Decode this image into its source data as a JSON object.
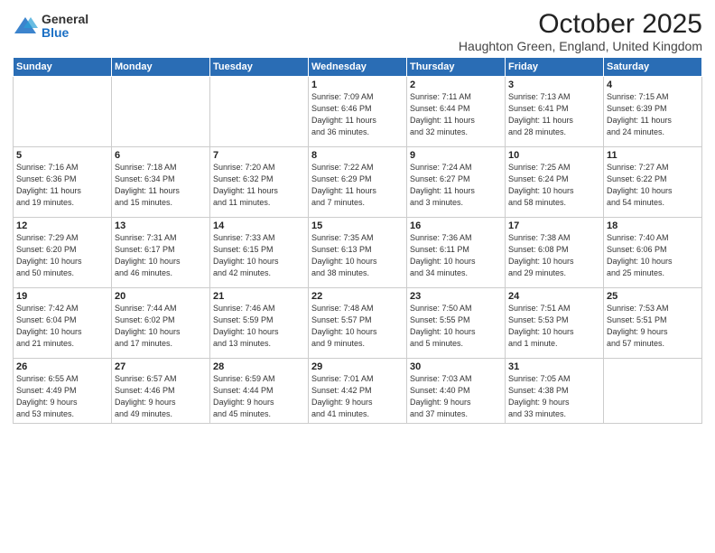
{
  "logo": {
    "general": "General",
    "blue": "Blue"
  },
  "title": "October 2025",
  "location": "Haughton Green, England, United Kingdom",
  "days_of_week": [
    "Sunday",
    "Monday",
    "Tuesday",
    "Wednesday",
    "Thursday",
    "Friday",
    "Saturday"
  ],
  "weeks": [
    [
      {
        "day": "",
        "info": ""
      },
      {
        "day": "",
        "info": ""
      },
      {
        "day": "",
        "info": ""
      },
      {
        "day": "1",
        "info": "Sunrise: 7:09 AM\nSunset: 6:46 PM\nDaylight: 11 hours\nand 36 minutes."
      },
      {
        "day": "2",
        "info": "Sunrise: 7:11 AM\nSunset: 6:44 PM\nDaylight: 11 hours\nand 32 minutes."
      },
      {
        "day": "3",
        "info": "Sunrise: 7:13 AM\nSunset: 6:41 PM\nDaylight: 11 hours\nand 28 minutes."
      },
      {
        "day": "4",
        "info": "Sunrise: 7:15 AM\nSunset: 6:39 PM\nDaylight: 11 hours\nand 24 minutes."
      }
    ],
    [
      {
        "day": "5",
        "info": "Sunrise: 7:16 AM\nSunset: 6:36 PM\nDaylight: 11 hours\nand 19 minutes."
      },
      {
        "day": "6",
        "info": "Sunrise: 7:18 AM\nSunset: 6:34 PM\nDaylight: 11 hours\nand 15 minutes."
      },
      {
        "day": "7",
        "info": "Sunrise: 7:20 AM\nSunset: 6:32 PM\nDaylight: 11 hours\nand 11 minutes."
      },
      {
        "day": "8",
        "info": "Sunrise: 7:22 AM\nSunset: 6:29 PM\nDaylight: 11 hours\nand 7 minutes."
      },
      {
        "day": "9",
        "info": "Sunrise: 7:24 AM\nSunset: 6:27 PM\nDaylight: 11 hours\nand 3 minutes."
      },
      {
        "day": "10",
        "info": "Sunrise: 7:25 AM\nSunset: 6:24 PM\nDaylight: 10 hours\nand 58 minutes."
      },
      {
        "day": "11",
        "info": "Sunrise: 7:27 AM\nSunset: 6:22 PM\nDaylight: 10 hours\nand 54 minutes."
      }
    ],
    [
      {
        "day": "12",
        "info": "Sunrise: 7:29 AM\nSunset: 6:20 PM\nDaylight: 10 hours\nand 50 minutes."
      },
      {
        "day": "13",
        "info": "Sunrise: 7:31 AM\nSunset: 6:17 PM\nDaylight: 10 hours\nand 46 minutes."
      },
      {
        "day": "14",
        "info": "Sunrise: 7:33 AM\nSunset: 6:15 PM\nDaylight: 10 hours\nand 42 minutes."
      },
      {
        "day": "15",
        "info": "Sunrise: 7:35 AM\nSunset: 6:13 PM\nDaylight: 10 hours\nand 38 minutes."
      },
      {
        "day": "16",
        "info": "Sunrise: 7:36 AM\nSunset: 6:11 PM\nDaylight: 10 hours\nand 34 minutes."
      },
      {
        "day": "17",
        "info": "Sunrise: 7:38 AM\nSunset: 6:08 PM\nDaylight: 10 hours\nand 29 minutes."
      },
      {
        "day": "18",
        "info": "Sunrise: 7:40 AM\nSunset: 6:06 PM\nDaylight: 10 hours\nand 25 minutes."
      }
    ],
    [
      {
        "day": "19",
        "info": "Sunrise: 7:42 AM\nSunset: 6:04 PM\nDaylight: 10 hours\nand 21 minutes."
      },
      {
        "day": "20",
        "info": "Sunrise: 7:44 AM\nSunset: 6:02 PM\nDaylight: 10 hours\nand 17 minutes."
      },
      {
        "day": "21",
        "info": "Sunrise: 7:46 AM\nSunset: 5:59 PM\nDaylight: 10 hours\nand 13 minutes."
      },
      {
        "day": "22",
        "info": "Sunrise: 7:48 AM\nSunset: 5:57 PM\nDaylight: 10 hours\nand 9 minutes."
      },
      {
        "day": "23",
        "info": "Sunrise: 7:50 AM\nSunset: 5:55 PM\nDaylight: 10 hours\nand 5 minutes."
      },
      {
        "day": "24",
        "info": "Sunrise: 7:51 AM\nSunset: 5:53 PM\nDaylight: 10 hours\nand 1 minute."
      },
      {
        "day": "25",
        "info": "Sunrise: 7:53 AM\nSunset: 5:51 PM\nDaylight: 9 hours\nand 57 minutes."
      }
    ],
    [
      {
        "day": "26",
        "info": "Sunrise: 6:55 AM\nSunset: 4:49 PM\nDaylight: 9 hours\nand 53 minutes."
      },
      {
        "day": "27",
        "info": "Sunrise: 6:57 AM\nSunset: 4:46 PM\nDaylight: 9 hours\nand 49 minutes."
      },
      {
        "day": "28",
        "info": "Sunrise: 6:59 AM\nSunset: 4:44 PM\nDaylight: 9 hours\nand 45 minutes."
      },
      {
        "day": "29",
        "info": "Sunrise: 7:01 AM\nSunset: 4:42 PM\nDaylight: 9 hours\nand 41 minutes."
      },
      {
        "day": "30",
        "info": "Sunrise: 7:03 AM\nSunset: 4:40 PM\nDaylight: 9 hours\nand 37 minutes."
      },
      {
        "day": "31",
        "info": "Sunrise: 7:05 AM\nSunset: 4:38 PM\nDaylight: 9 hours\nand 33 minutes."
      },
      {
        "day": "",
        "info": ""
      }
    ]
  ]
}
